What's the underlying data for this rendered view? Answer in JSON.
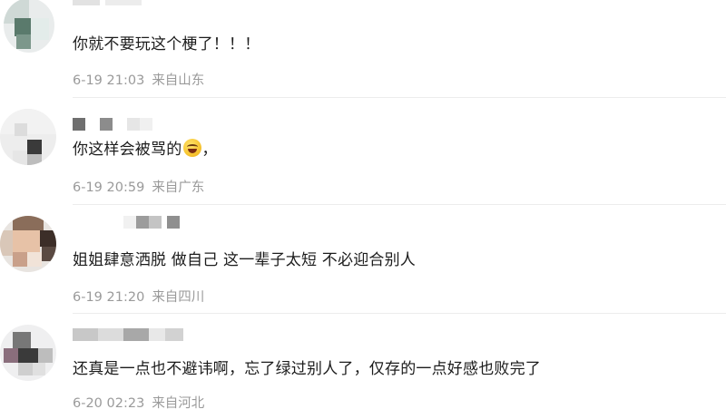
{
  "comments": [
    {
      "text": "你就不要玩这个梗了！！！",
      "time": "6-19 21:03",
      "location": "来自山东"
    },
    {
      "text": "你这样会被骂的",
      "emoji_after": "，",
      "emoji_icon": "laughing-crying-emoji",
      "time": "6-19 20:59",
      "location": "来自广东"
    },
    {
      "text": "姐姐肆意洒脱 做自己 这一辈子太短 不必迎合别人",
      "time": "6-19 21:20",
      "location": "来自四川"
    },
    {
      "text": "还真是一点也不避讳啊，忘了绿过别人了，仅存的一点好感也败完了",
      "time": "6-20 02:23",
      "location": "来自河北"
    }
  ]
}
